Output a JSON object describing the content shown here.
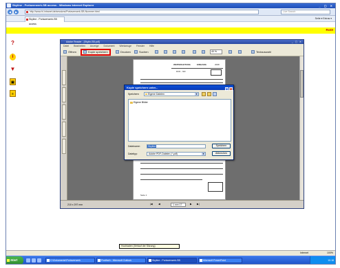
{
  "browser": {
    "title": "Skyline - Portaverwerk-SB access - Windows Internet Explorer",
    "url": "http://www.hl-intranet.de/sessions/Portaverwerk-SB-Nummer.html",
    "search_placeholder": "Live Search",
    "tab_label": "Skyline - Portaverwerk-SB access",
    "command_bar": "Seite ▾  Extras ▾",
    "window_controls": "_ ▢ ✕"
  },
  "portal": {
    "brand": "RoDI",
    "icons": [
      "help-icon",
      "info-icon",
      "down-arrow-icon",
      "save-icon",
      "list-icon"
    ]
  },
  "adobe": {
    "title": "Adobe Reader - [Skylin-SB.pdf]",
    "menu": [
      "Datei",
      "Bearbeiten",
      "Anzeige",
      "Dokument",
      "Werkzeuge",
      "Fenster",
      "Hilfe"
    ],
    "toolbar": {
      "open": "Öffnen",
      "save_copy": "Kopie speichern",
      "print": "Drucken",
      "search": "Suchen",
      "zoom": "40 %",
      "tools": "Textauswahl"
    },
    "status_size": "210 x 297 mm",
    "page_indicator": "1 von 17"
  },
  "pdf_page": {
    "header_left": "WEITERLEITUNG",
    "header_stamp": "EINGANG",
    "header_right": "2008",
    "code": "DOK - NR.",
    "box_label": "SB",
    "footer_note": "Seite 1"
  },
  "dialog": {
    "title": "Kopie speichern unter...",
    "save_in_label": "Speichern",
    "save_in_value": "Eigene Dateien",
    "file_item": "Eigene Bilder",
    "filename_label": "Dateiname:",
    "filename_value": "Skyline",
    "filetype_label": "Dateityp:",
    "filetype_value": "Adobe PDF-Dateien (*.pdf)",
    "save_button": "Speichern",
    "cancel_button": "Abbrechen",
    "close_glyph": "x",
    "help_glyph": "?"
  },
  "tooltip": "Hochladen (Verlauf der Sitzung)",
  "ie_status": {
    "zone": "Internet",
    "zoom": "100%"
  },
  "taskbar": {
    "start": "Start",
    "tasks": [
      "C:\\Dokumente\\Portaverwerk",
      "Postfach - Microsoft Outlook",
      "Skyline - Portaverwerk-SB",
      "Microsoft PowerPoint"
    ],
    "clock": "10:18"
  }
}
